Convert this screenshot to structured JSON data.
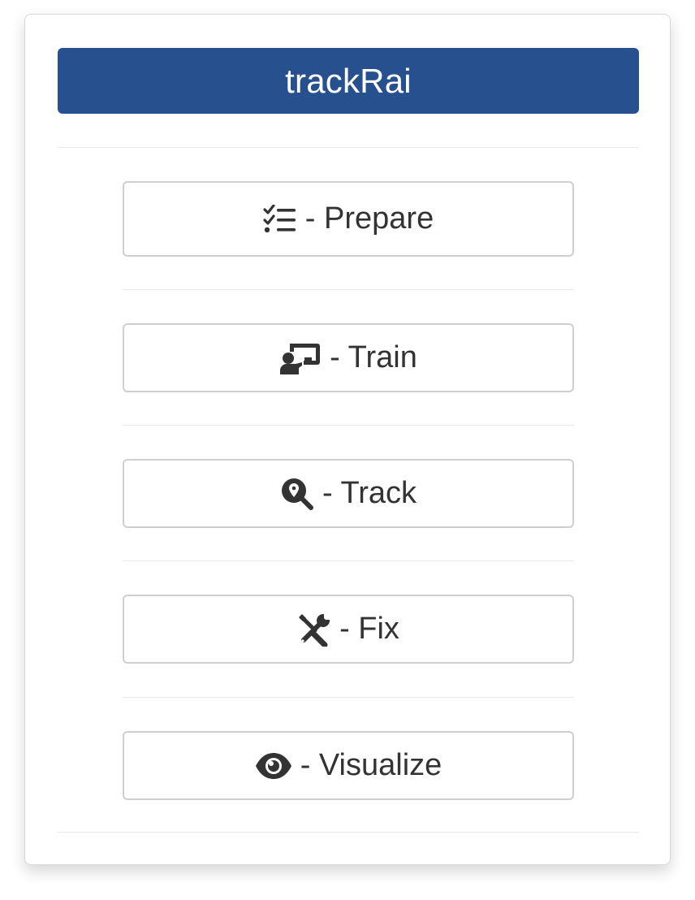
{
  "app": {
    "title": "trackRai"
  },
  "menu": {
    "items": [
      {
        "label": "- Prepare",
        "icon": "checklist-icon"
      },
      {
        "label": "- Train",
        "icon": "teacher-icon"
      },
      {
        "label": "- Track",
        "icon": "search-location-icon"
      },
      {
        "label": "- Fix",
        "icon": "tools-icon"
      },
      {
        "label": "- Visualize",
        "icon": "eye-icon"
      }
    ]
  },
  "colors": {
    "title_bar": "#27508e",
    "button_text": "#333333",
    "button_border": "#cfcfcf"
  }
}
